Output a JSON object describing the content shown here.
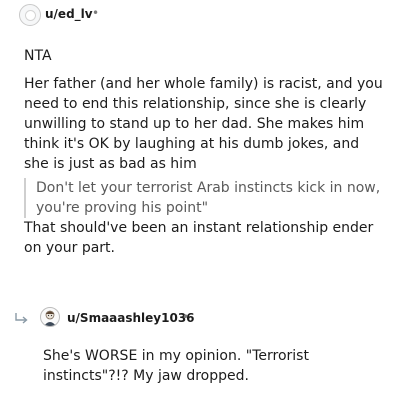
{
  "comment": {
    "username": "u/ed_lv",
    "separator": "•",
    "lines": [
      "NTA",
      "Her father (and her whole family) is racist, and you need to end this relationship, since she is clearly unwilling to stand up to her dad. She makes him think it's OK by laughing at his dumb jokes, and she is just as bad as him"
    ],
    "quote": "Don't let your terrorist Arab instincts kick in now, you're proving his point\"",
    "closing": "That should've been an instant relationship ender on your part."
  },
  "reply": {
    "username": "u/Smaaashley1036",
    "separator": "•",
    "text": "She's WORSE in my opinion. \"Terrorist instincts\"?!? My jaw dropped."
  },
  "icons": {
    "avatar": "user-avatar-icon",
    "reply_arrow": "reply-arrow-icon",
    "reply_avatar": "user-avatar-icon"
  }
}
